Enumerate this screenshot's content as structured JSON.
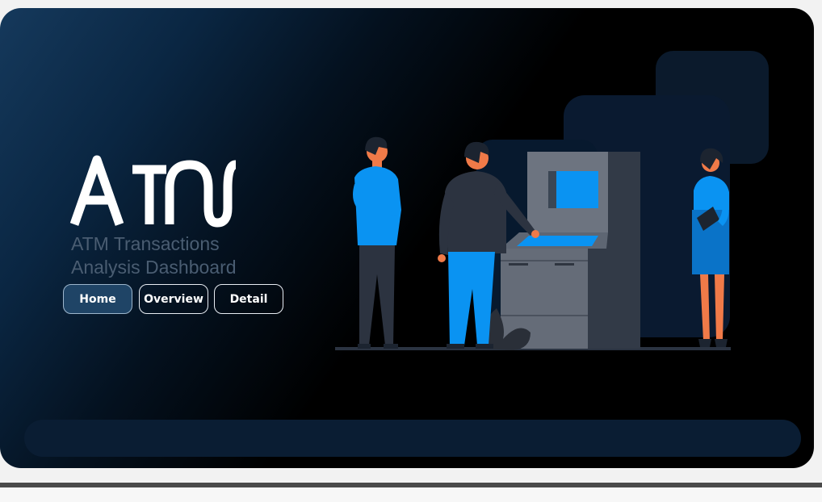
{
  "hero": {
    "logo_text": "ATM",
    "subtitle_line1": "ATM Transactions",
    "subtitle_line2": "Analysis Dashboard"
  },
  "nav": {
    "items": [
      {
        "label": "Home",
        "active": true
      },
      {
        "label": "Overview",
        "active": false
      },
      {
        "label": "Detail",
        "active": false
      }
    ]
  },
  "colors": {
    "accent_blue": "#0a93f2",
    "nav_active_bg": "#1f4466",
    "subtitle": "#4a5d72",
    "background_dark": "#000000"
  },
  "illustration": {
    "icon": "atm-users-illustration"
  }
}
